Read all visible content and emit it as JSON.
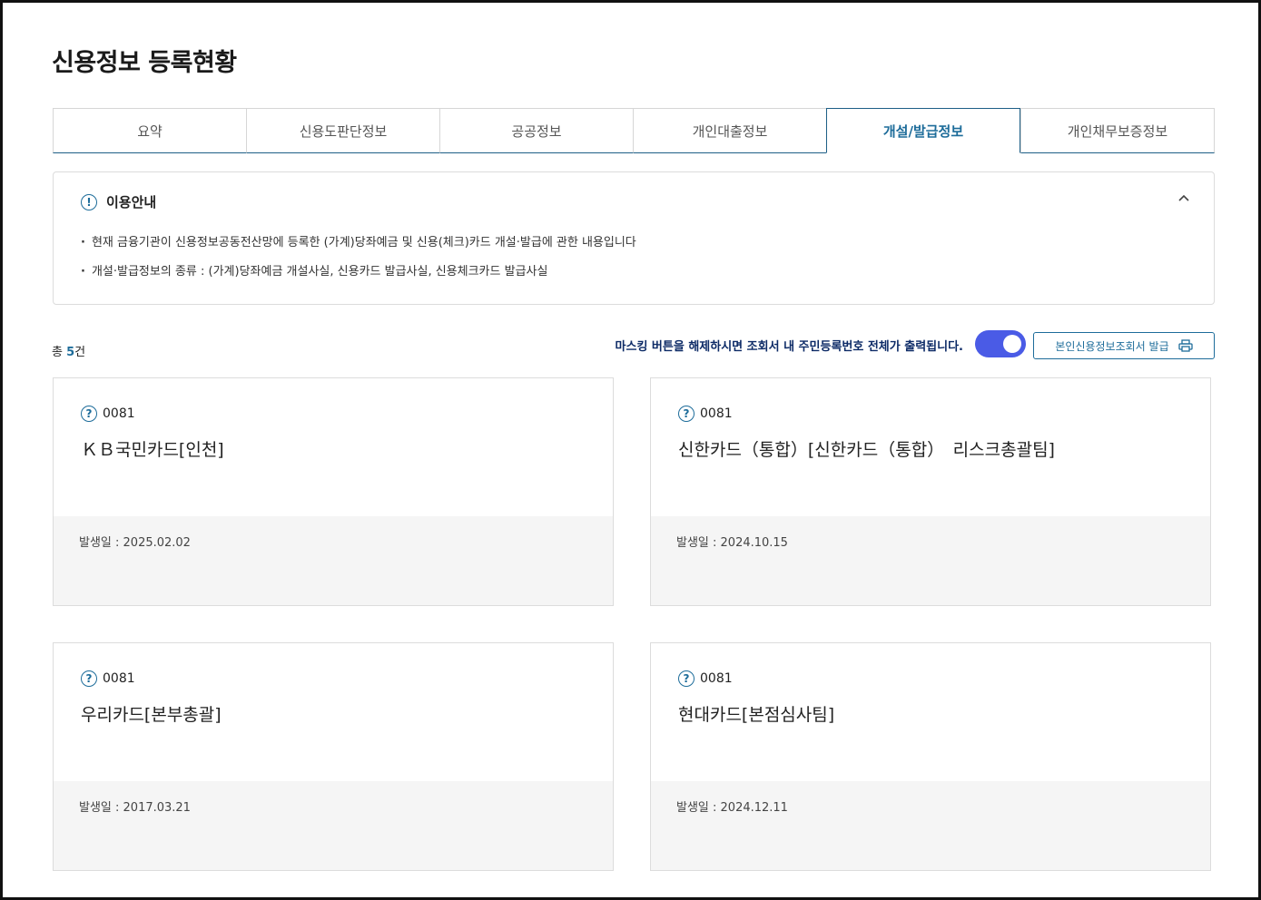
{
  "page": {
    "title": "신용정보 등록현황"
  },
  "tabs": [
    {
      "label": "요약",
      "active": false
    },
    {
      "label": "신용도판단정보",
      "active": false
    },
    {
      "label": "공공정보",
      "active": false
    },
    {
      "label": "개인대출정보",
      "active": false
    },
    {
      "label": "개설/발급정보",
      "active": true
    },
    {
      "label": "개인채무보증정보",
      "active": false
    }
  ],
  "notice": {
    "icon": "exclamation-circle-icon",
    "title": "이용안내",
    "collapse_icon": "chevron-up-icon",
    "items": [
      "현재 금융기관이 신용정보공동전산망에 등록한 (가계)당좌예금 및 신용(체크)카드 개설·발급에 관한 내용입니다",
      "개설·발급정보의 종류 : (가계)당좌예금 개설사실, 신용카드 발급사실, 신용체크카드 발급사실"
    ]
  },
  "summary": {
    "count_prefix": "총 ",
    "count": "5",
    "count_suffix": "건"
  },
  "masking": {
    "message": "마스킹 버튼을 해제하시면 조회서 내 주민등록번호 전체가 출력됩니다.",
    "toggle_on": true,
    "toggle_color": "#4a5be6"
  },
  "issue_button": {
    "label": "본인신용정보조회서 발급",
    "icon": "printer-icon"
  },
  "cards": [
    {
      "code": "0081",
      "name": "ＫＢ국민카드[인천]",
      "date": "발생일 : 2025.02.02"
    },
    {
      "code": "0081",
      "name": "신한카드（통합）[신한카드（통합）　리스크총괄팀]",
      "date": "발생일 : 2024.10.15"
    },
    {
      "code": "0081",
      "name": "우리카드[본부총괄]",
      "date": "발생일 : 2017.03.21"
    },
    {
      "code": "0081",
      "name": "현대카드[본점심사팀]",
      "date": "발생일 : 2024.12.11"
    }
  ],
  "colors": {
    "accent": "#1d6c9a",
    "active_tab_border": "#1d5e86",
    "mask_text": "#0c2a66"
  }
}
